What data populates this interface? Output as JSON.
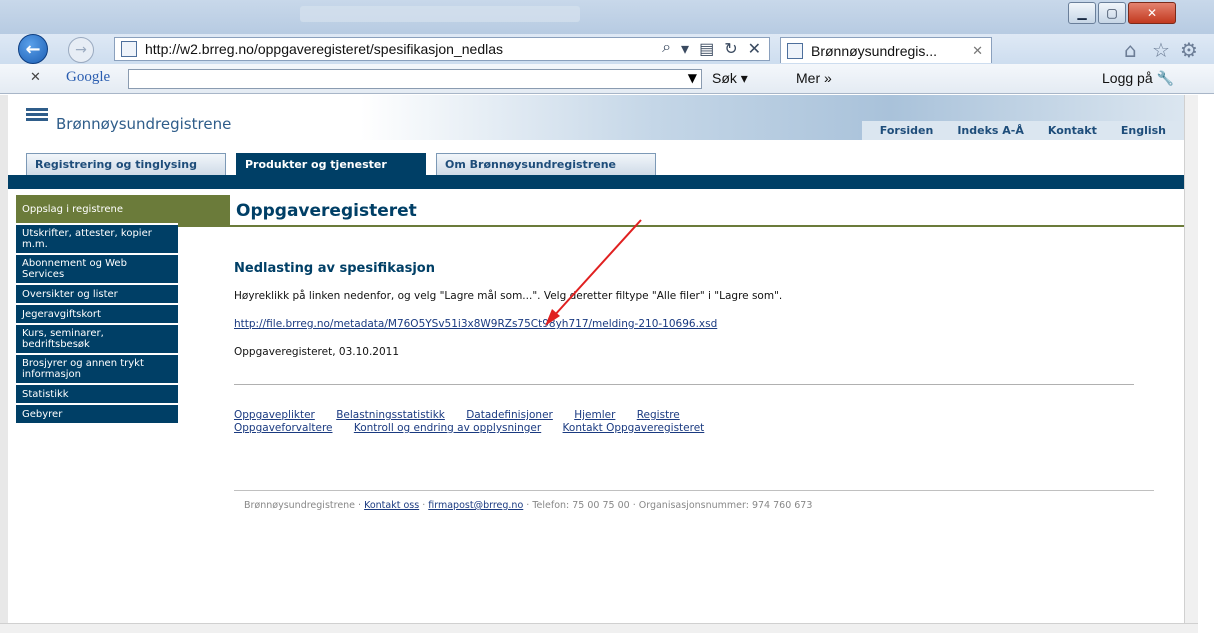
{
  "browser": {
    "url": "http://w2.brreg.no/oppgaveregisteret/spesifikasjon_nedlas",
    "tab_title": "Brønnøysundregis...",
    "google": {
      "logo": "Google",
      "search_button": "Søk",
      "more": "Mer",
      "login": "Logg på"
    }
  },
  "site": {
    "name": "Brønnøysundregistrene",
    "top_links": [
      "Forsiden",
      "Indeks A-Å",
      "Kontakt",
      "English"
    ],
    "tabs": [
      "Registrering og tinglysing",
      "Produkter og tjenester",
      "Om Brønnøysundregistrene"
    ],
    "menu": [
      "Oppslag i registrene",
      "Utskrifter, attester, kopier m.m.",
      "Abonnement og Web Services",
      "Oversikter og lister",
      "Jegeravgiftskort",
      "Kurs, seminarer, bedriftsbesøk",
      "Brosjyrer og annen trykt informasjon",
      "Statistikk",
      "Gebyrer"
    ],
    "page_title": "Oppgaveregisteret",
    "content": {
      "heading": "Nedlasting av spesifikasjon",
      "instruction": "Høyreklikk på linken nedenfor, og velg \"Lagre mål som...\". Velg deretter filtype \"Alle filer\" i \"Lagre som\".",
      "link": "http://file.brreg.no/metadata/M76O5YSv51i3x8W9RZs75Ct98yh717/melding-210-10696.xsd",
      "date_line": "Oppgaveregisteret, 03.10.2011"
    },
    "bottom_links_row1": [
      "Oppgaveplikter",
      "Belastningsstatistikk",
      "Datadefinisjoner",
      "Hjemler",
      "Registre"
    ],
    "bottom_links_row2": [
      "Oppgaveforvaltere",
      "Kontroll og endring av opplysninger",
      "Kontakt Oppgaveregisteret"
    ],
    "footer": {
      "org": "Brønnøysundregistrene",
      "contact": "Kontakt oss",
      "email": "firmapost@brreg.no",
      "phone": "Telefon: 75 00 75 00",
      "orgnr": "Organisasjonsnummer: 974 760 673"
    }
  }
}
